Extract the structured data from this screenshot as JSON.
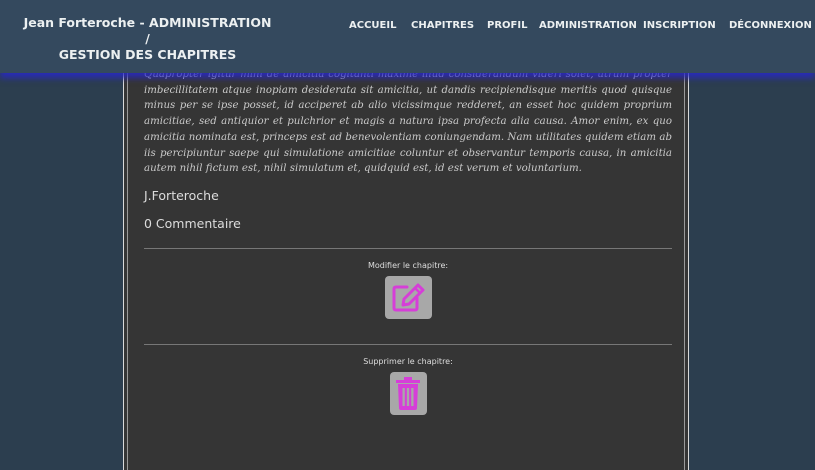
{
  "header": {
    "brand_line1": "Jean Forteroche - ADMINISTRATION /",
    "brand_line2": "GESTION DES CHAPITRES",
    "nav": [
      {
        "label": "ACCUEIL"
      },
      {
        "label": "CHAPITRES"
      },
      {
        "label": "PROFIL"
      },
      {
        "label": "ADMINISTRATION"
      },
      {
        "label": "INSCRIPTION"
      },
      {
        "label": "DÉCONNEXION"
      }
    ]
  },
  "chapter": {
    "text": "Quapropter igitur mihi de amicitia cogitanti maxime illud considerandum videri solet, utrum propter imbecillitatem atque inopiam desiderata sit amicitia, ut dandis recipiendisque meritis quod quisque minus per se ipse posset, id acciperet ab alio vicissimque redderet, an esset hoc quidem proprium amicitiae, sed antiquior et pulchrior et magis a natura ipsa profecta alia causa. Amor enim, ex quo amicitia nominata est, princeps est ad benevolentiam coniungendam. Nam utilitates quidem etiam ab iis percipiuntur saepe qui simulatione amicitiae coluntur et observantur temporis causa, in amicitia autem nihil fictum est, nihil simulatum et, quidquid est, id est verum et voluntarium.",
    "author": "J.Forteroche",
    "comments": "0 Commentaire"
  },
  "actions": {
    "edit_label": "Modifier le chapitre:",
    "edit_icon": "edit-icon",
    "delete_label": "Supprimer le chapitre:",
    "delete_icon": "trash-icon"
  },
  "colors": {
    "page_bg": "#2c3e4f",
    "header_bg": "#34495e",
    "card_bg": "#353535",
    "icon_magenta": "#d63ed8",
    "button_grey": "#a8a8a8"
  }
}
